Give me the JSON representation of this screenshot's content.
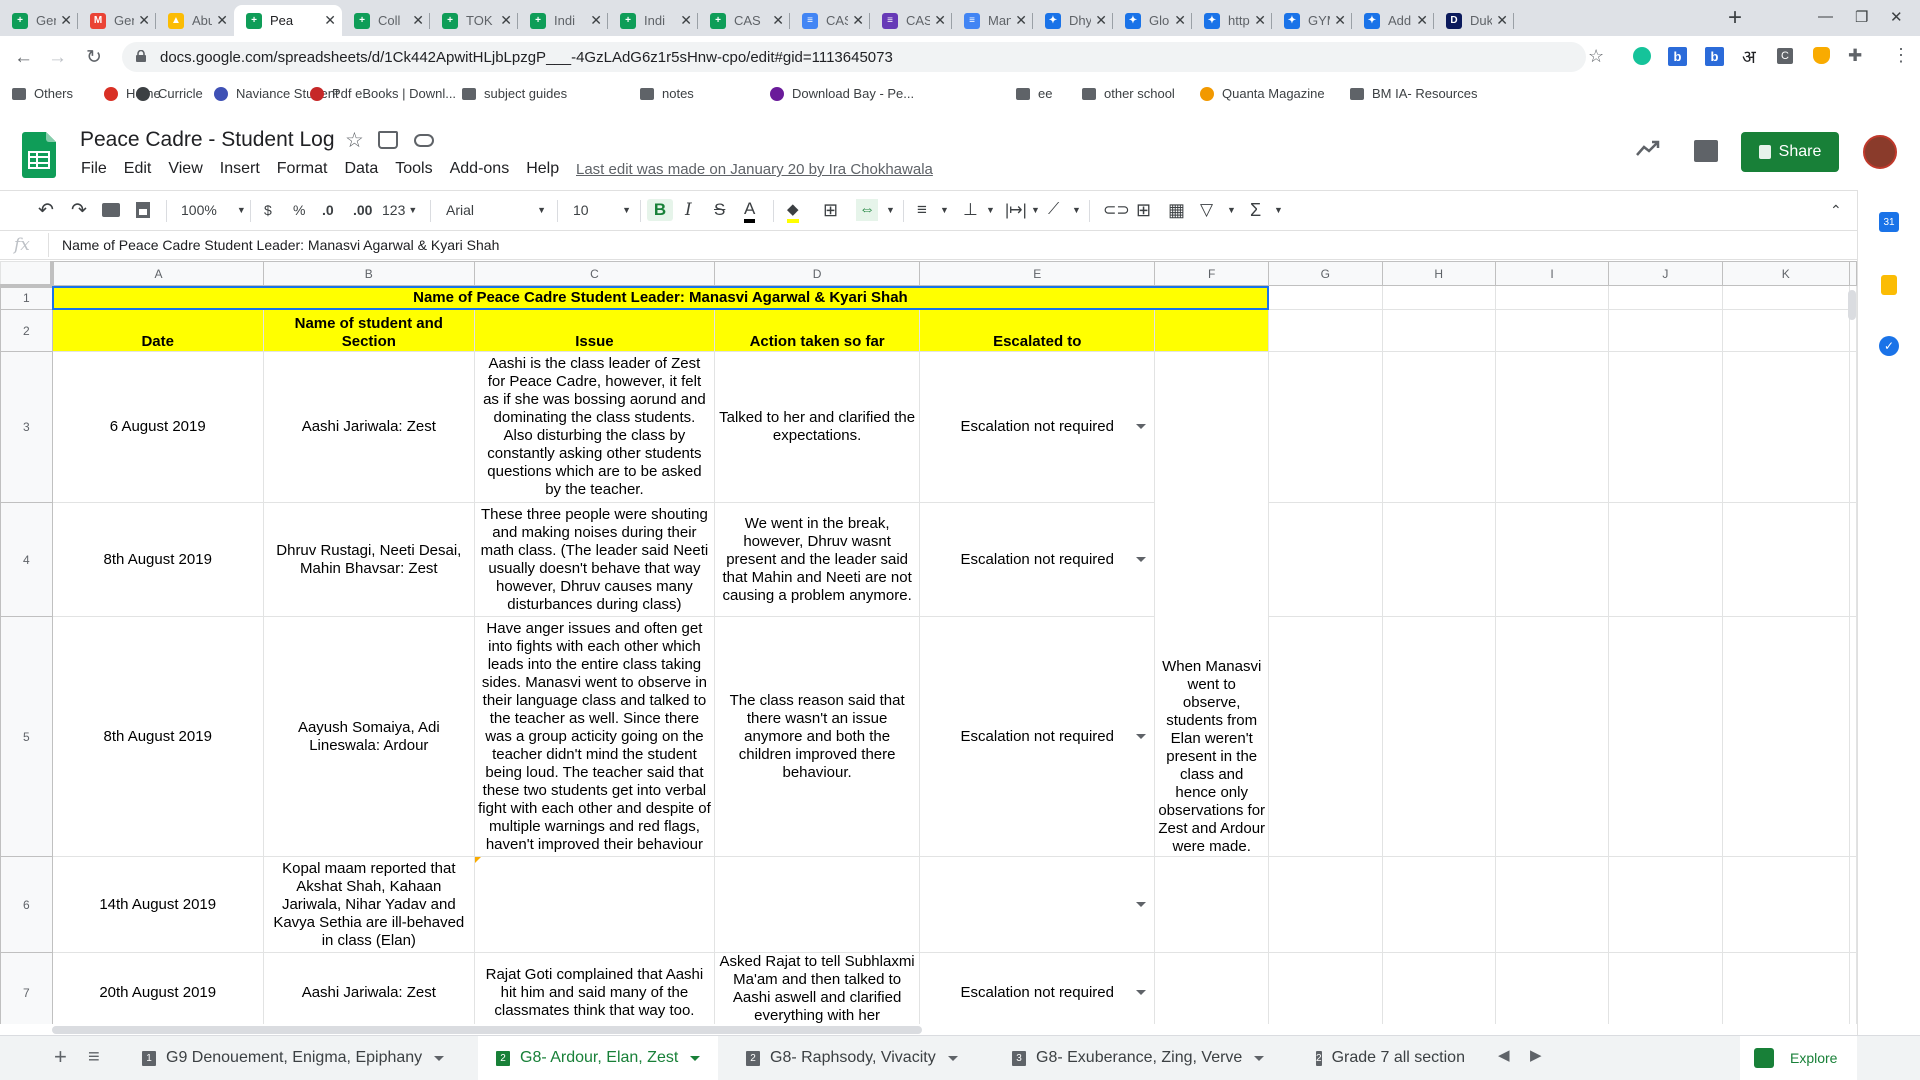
{
  "browser": {
    "tabs": [
      {
        "title": "Gen",
        "fav_color": "#0f9d58",
        "fav_glyph": "+"
      },
      {
        "title": "Gen",
        "fav_color": "#ea4335",
        "fav_glyph": "M"
      },
      {
        "title": "Abu",
        "fav_color": "#fbbc04",
        "fav_glyph": "▲"
      },
      {
        "title": "Pea",
        "fav_color": "#0f9d58",
        "fav_glyph": "+"
      },
      {
        "title": "Coll",
        "fav_color": "#0f9d58",
        "fav_glyph": "+"
      },
      {
        "title": "TOK",
        "fav_color": "#0f9d58",
        "fav_glyph": "+"
      },
      {
        "title": "Indi",
        "fav_color": "#0f9d58",
        "fav_glyph": "+"
      },
      {
        "title": "Indi",
        "fav_color": "#0f9d58",
        "fav_glyph": "+"
      },
      {
        "title": "CAS",
        "fav_color": "#0f9d58",
        "fav_glyph": "+"
      },
      {
        "title": "CAS",
        "fav_color": "#4285f4",
        "fav_glyph": "≡"
      },
      {
        "title": "CAS",
        "fav_color": "#673ab7",
        "fav_glyph": "≡"
      },
      {
        "title": "Man",
        "fav_color": "#4285f4",
        "fav_glyph": "≡"
      },
      {
        "title": "Dhy",
        "fav_color": "#1a73e8",
        "fav_glyph": "✦"
      },
      {
        "title": "Glob",
        "fav_color": "#1a73e8",
        "fav_glyph": "✦"
      },
      {
        "title": "http",
        "fav_color": "#1a73e8",
        "fav_glyph": "✦"
      },
      {
        "title": "GYM",
        "fav_color": "#1a73e8",
        "fav_glyph": "✦"
      },
      {
        "title": "Add",
        "fav_color": "#1a73e8",
        "fav_glyph": "✦"
      },
      {
        "title": "Duk",
        "fav_color": "#0b1a5c",
        "fav_glyph": "D"
      }
    ],
    "url": "docs.google.com/spreadsheets/d/1Ck442ApwitHLjbLpzgP___-4GzLAdG6z1r5sHnw-cpo/edit#gid=1113645073",
    "bookmarks": [
      "Others",
      "Home",
      "Curricle",
      "Naviance Student",
      "Pdf eBooks | Downl...",
      "subject guides",
      "notes",
      "Download  Bay - Pe...",
      "ee",
      "other school",
      "Quanta Magazine",
      "BM IA- Resources"
    ]
  },
  "doc": {
    "title": "Peace Cadre - Student Log",
    "menus": [
      "File",
      "Edit",
      "View",
      "Insert",
      "Format",
      "Data",
      "Tools",
      "Add-ons",
      "Help"
    ],
    "last_edit": "Last edit was made on January 20 by Ira Chokhawala",
    "share_label": "Share"
  },
  "toolbar": {
    "zoom": "100%",
    "currency": "$",
    "percent": "%",
    "dec_less": ".0",
    "dec_more": ".00",
    "more_formats": "123",
    "font": "Arial",
    "font_size": "10"
  },
  "formula_bar": {
    "fx": "fx",
    "content": "Name of Peace Cadre Student Leader: Manasvi Agarwal & Kyari Shah"
  },
  "sheet": {
    "columns": [
      "A",
      "B",
      "C",
      "D",
      "E",
      "F",
      "G",
      "H",
      "I",
      "J",
      "K"
    ],
    "row_numbers": [
      "1",
      "2",
      "3",
      "4",
      "5",
      "6",
      "7"
    ],
    "title_row": "Name of Peace Cadre Student Leader: Manasvi Agarwal & Kyari Shah",
    "headers": [
      "Date",
      "Name of student and Section",
      "Issue",
      "Action taken so far",
      "Escalated to",
      ""
    ],
    "rows": [
      {
        "date": "6 August 2019",
        "student": "Aashi Jariwala: Zest",
        "issue": "Aashi is the class leader of Zest for Peace Cadre, however, it felt as if she was bossing aorund and dominating the class students. Also disturbing the class by constantly asking other students questions which are to be asked by the teacher.",
        "action": "Talked to her and clarified the expectations.",
        "escalated": "Escalation not required"
      },
      {
        "date": "8th August 2019",
        "student": "Dhruv Rustagi, Neeti Desai, Mahin Bhavsar: Zest",
        "issue": "These three people were shouting and making noises during their math class. (The leader said Neeti usually doesn't behave that way however, Dhruv causes many disturbances during class)",
        "action": "We went in the break, however, Dhruv wasnt present and the leader said that Mahin and Neeti are not causing a problem anymore.",
        "escalated": "Escalation not required"
      },
      {
        "date": "8th August 2019",
        "student": "Aayush Somaiya, Adi Lineswala: Ardour",
        "issue": "Have anger issues and often get into fights with each other which leads into the entire class taking sides. Manasvi went to observe in their language class and talked to the teacher as well. Since there was a group acticity going on the teacher didn't mind the student being loud. The teacher said that these two students get into verbal fight with each other and despite of multiple warnings and red flags, haven't improved their behaviour",
        "action": "The class reason said that there wasn't an issue anymore and both the children improved there behaviour.",
        "escalated": "Escalation not required"
      },
      {
        "date": "14th August 2019",
        "student": "Kopal maam reported that Akshat Shah, Kahaan Jariwala, Nihar Yadav and Kavya Sethia are ill-behaved in class (Elan)",
        "issue": "",
        "action": "",
        "escalated": ""
      },
      {
        "date": "20th August 2019",
        "student": "Aashi Jariwala: Zest",
        "issue": "Rajat Goti complained that Aashi hit him and said many of the classmates think that way too.",
        "action": "Asked Rajat to tell Subhlaxmi Ma'am and then talked to Aashi aswell and clarified everything with her",
        "escalated": "Escalation not required"
      }
    ],
    "merged_f_note": "When Manasvi went to observe, students from Elan weren't present in the class and hence only observations for Zest and Ardour were made."
  },
  "sheet_tabs": [
    {
      "num": "1",
      "label": "G9 Denouement, Enigma, Epiphany",
      "active": false
    },
    {
      "num": "2",
      "label": "G8- Ardour, Elan, Zest",
      "active": true
    },
    {
      "num": "2",
      "label": "G8- Raphsody, Vivacity",
      "active": false
    },
    {
      "num": "3",
      "label": "G8- Exuberance, Zing, Verve",
      "active": false
    },
    {
      "num": "2",
      "label": "Grade 7 all section",
      "active": false
    }
  ],
  "explore_label": "Explore",
  "colors": {
    "accent": "#188038",
    "highlight": "#ffff00",
    "selection": "#1a73e8"
  }
}
